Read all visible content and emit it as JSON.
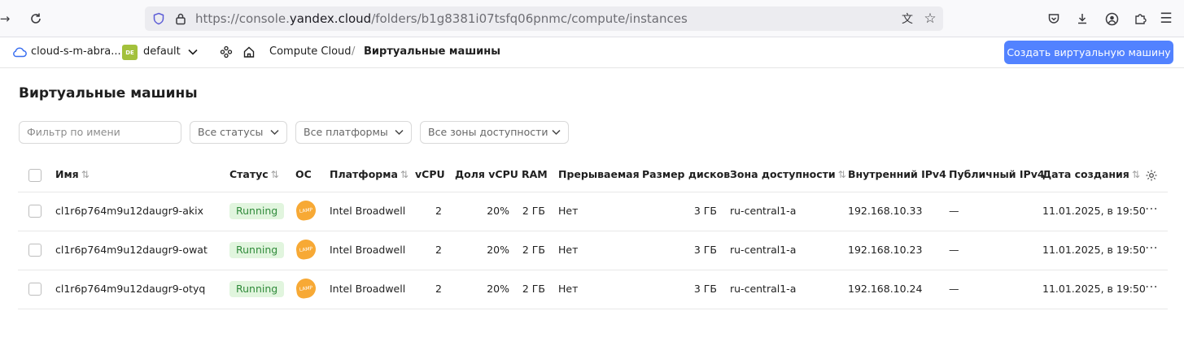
{
  "browser": {
    "url_prefix": "https://console.",
    "url_domain": "yandex.cloud",
    "url_path": "/folders/b1g8381i07tsfq06pnmc/compute/instances"
  },
  "header": {
    "cloud_name": "cloud-s-m-abra...",
    "folder_badge": "DE",
    "folder_name": "default",
    "breadcrumb_service": "Compute Cloud",
    "breadcrumb_separator": "/",
    "breadcrumb_current": "Виртуальные машины",
    "create_button": "Создать виртуальную машину"
  },
  "page": {
    "title": "Виртуальные машины"
  },
  "filters": {
    "name_placeholder": "Фильтр по имени",
    "status": "Все статусы",
    "platform": "Все платформы",
    "zone": "Все зоны доступности"
  },
  "table": {
    "columns": {
      "name": "Имя",
      "status": "Статус",
      "os": "ОС",
      "platform": "Платформа",
      "vcpu": "vCPU",
      "vcpu_share": "Доля vCPU",
      "ram": "RAM",
      "preemptible": "Прерываемая",
      "disk_size": "Размер дисков",
      "zone": "Зона доступности",
      "internal_ip": "Внутренний IPv4",
      "public_ip": "Публичный IPv4",
      "created": "Дата создания"
    },
    "rows": [
      {
        "name": "cl1r6p764m9u12daugr9-akix",
        "status": "Running",
        "os": "LAMP",
        "platform": "Intel Broadwell",
        "vcpu": "2",
        "vcpu_share": "20%",
        "ram": "2 ГБ",
        "preemptible": "Нет",
        "disk_size": "3 ГБ",
        "zone": "ru-central1-a",
        "internal_ip": "192.168.10.33",
        "public_ip": "—",
        "created": "11.01.2025, в 19:50"
      },
      {
        "name": "cl1r6p764m9u12daugr9-owat",
        "status": "Running",
        "os": "LAMP",
        "platform": "Intel Broadwell",
        "vcpu": "2",
        "vcpu_share": "20%",
        "ram": "2 ГБ",
        "preemptible": "Нет",
        "disk_size": "3 ГБ",
        "zone": "ru-central1-a",
        "internal_ip": "192.168.10.23",
        "public_ip": "—",
        "created": "11.01.2025, в 19:50"
      },
      {
        "name": "cl1r6p764m9u12daugr9-otyq",
        "status": "Running",
        "os": "LAMP",
        "platform": "Intel Broadwell",
        "vcpu": "2",
        "vcpu_share": "20%",
        "ram": "2 ГБ",
        "preemptible": "Нет",
        "disk_size": "3 ГБ",
        "zone": "ru-central1-a",
        "internal_ip": "192.168.10.24",
        "public_ip": "—",
        "created": "11.01.2025, в 19:50"
      }
    ]
  },
  "colors": {
    "accent": "#5282ff",
    "running_bg": "#e1f5de",
    "running_text": "#2f8a3a",
    "lamp": "#f7a935"
  }
}
